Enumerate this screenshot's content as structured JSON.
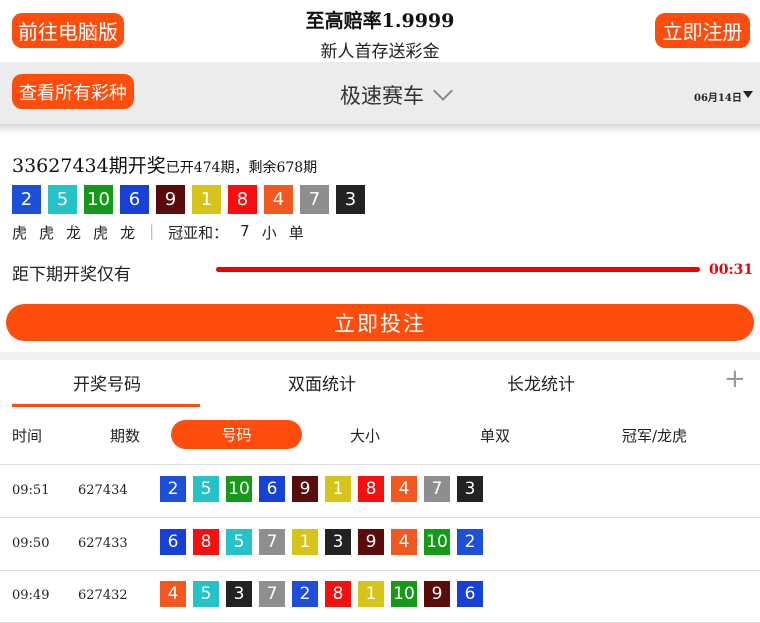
{
  "header": {
    "pc_button": "前往电脑版",
    "slogan_line1": "至高赔率1.9999",
    "slogan_line2": "新人首存送彩金",
    "register_button": "立即注册"
  },
  "nav": {
    "all_lottery_button": "查看所有彩种",
    "game_title": "极速赛车",
    "date": "06月14日"
  },
  "draw": {
    "issue_title": "33627434期开奖",
    "issue_sub": "已开474期，剩余678期",
    "numbers": [
      2,
      5,
      10,
      6,
      9,
      1,
      8,
      4,
      7,
      3
    ],
    "longhu": [
      "虎",
      "虎",
      "龙",
      "虎",
      "龙"
    ],
    "guanya_label": "冠亚和：",
    "guanya_sum": "7",
    "guanya_size": "小",
    "guanya_parity": "单",
    "countdown_label": "距下期开奖仅有",
    "countdown_time": "00:31",
    "bet_button": "立即投注"
  },
  "tabs": {
    "t1": "开奖号码",
    "t2": "双面统计",
    "t3": "长龙统计",
    "plus": "+"
  },
  "table": {
    "headers": {
      "time": "时间",
      "issue": "期数",
      "number": "号码",
      "size": "大小",
      "parity": "单双",
      "champion": "冠军/龙虎"
    },
    "rows": [
      {
        "time": "09:51",
        "issue": "627434",
        "numbers": [
          2,
          5,
          10,
          6,
          9,
          1,
          8,
          4,
          7,
          3
        ]
      },
      {
        "time": "09:50",
        "issue": "627433",
        "numbers": [
          6,
          8,
          5,
          7,
          1,
          3,
          9,
          4,
          10,
          2
        ]
      },
      {
        "time": "09:49",
        "issue": "627432",
        "numbers": [
          4,
          5,
          3,
          7,
          2,
          8,
          1,
          10,
          9,
          6
        ]
      }
    ]
  },
  "ball_colors": {
    "1": "#d6c41a",
    "2": "#1d4fd8",
    "3": "#222222",
    "4": "#f2581f",
    "5": "#25c3c8",
    "6": "#1740d6",
    "7": "#8e8e8e",
    "8": "#f5100f",
    "9": "#5a0b0b",
    "10": "#159a18"
  }
}
